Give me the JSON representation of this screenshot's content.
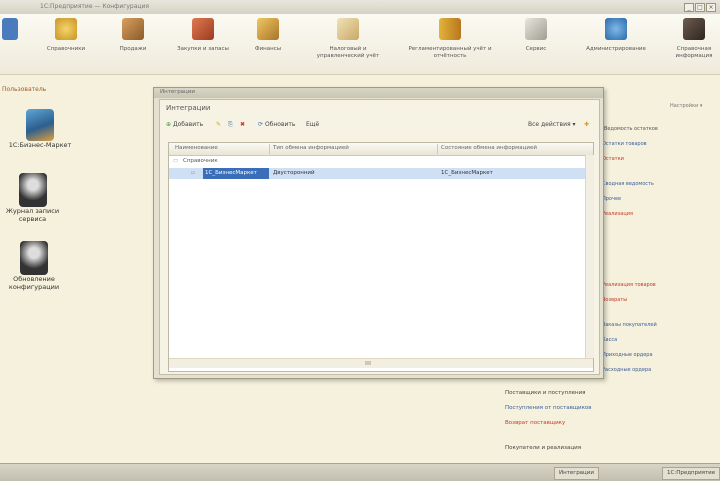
{
  "window": {
    "title": "1С:Предприятие — Конфигурация",
    "minimize": "_",
    "maximize": "□",
    "close": "×"
  },
  "toolbar": {
    "items": [
      {
        "id": "tb-0",
        "label": "",
        "color": "#4a7bbd"
      },
      {
        "id": "tb-1",
        "label": "Справочники",
        "color": "#e2b23c"
      },
      {
        "id": "tb-2",
        "label": "Продажи",
        "color": "#b8823a"
      },
      {
        "id": "tb-3",
        "label": "Закупки и запасы",
        "color": "#c04a32"
      },
      {
        "id": "tb-4",
        "label": "Финансы",
        "color": "#d4a03c"
      },
      {
        "id": "tb-5",
        "label": "Налоговый и управленческий учёт",
        "color": "#c9a866"
      },
      {
        "id": "tb-6",
        "label": "Регламентированный учёт и отчётность",
        "color": "#cf9a2e"
      },
      {
        "id": "tb-7",
        "label": "Сервис",
        "color": "#b2b0a3"
      },
      {
        "id": "tb-8",
        "label": "Администрирование",
        "color": "#3d86c6"
      },
      {
        "id": "tb-9",
        "label": "Справочная информация",
        "color": "#5a4a40"
      }
    ]
  },
  "leftpanel": {
    "header": "Пользователь",
    "items": [
      {
        "label": "1С:Бизнес-Маркет"
      },
      {
        "label": "Журнал записи сервиса"
      },
      {
        "label": "Обновление конфигурации"
      }
    ]
  },
  "dialog": {
    "title": "Интеграции",
    "heading": "Интеграции",
    "toolbar": {
      "add": "Добавить",
      "edit": "✎",
      "copy": "⎘",
      "delete": "✖",
      "refresh": "Обновить",
      "more": "Ещё",
      "actions": "Все действия ▾"
    },
    "columns": [
      "Наименование",
      "Тип обмена информацией",
      "Состояние обмена информацией"
    ],
    "rows": [
      {
        "level": 0,
        "name": "Справочник",
        "type": "",
        "state": "",
        "selected": false
      },
      {
        "level": 1,
        "name": "1С_БизнесМаркет",
        "type": "Двусторонний",
        "state": "1С_БизнесМаркет",
        "selected": true
      }
    ]
  },
  "rightpanel": {
    "top_link": "Настройки ▾",
    "groups": [
      {
        "title": "Ведомость остатков",
        "links": [
          "Остатки товаров",
          "Остатки",
          "Сводная ведомость",
          "Прочее"
        ]
      },
      {
        "title": "Реализация",
        "links": [
          "Реализация товаров",
          "Возвраты",
          "Заказы покупателей"
        ]
      },
      {
        "title": "Касса",
        "links": [
          "Приходные ордера",
          "Расходные ордера"
        ]
      }
    ],
    "bottom": {
      "group1_title": "Поставщики и поступления",
      "group1_links": [
        "Поступления от поставщиков",
        "Возврат поставщику"
      ],
      "group2_title": "Покупатели и реализация"
    }
  },
  "taskbar": {
    "items": [
      "Интеграции",
      "1С:Предприятие"
    ]
  }
}
